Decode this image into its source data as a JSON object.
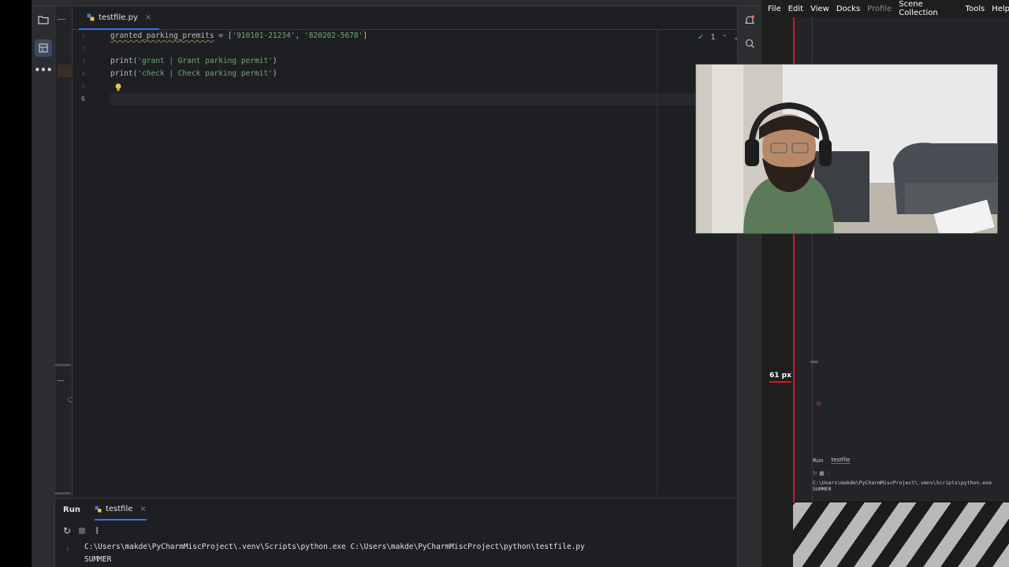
{
  "editor": {
    "file_tab": "testfile.py",
    "tab_close": "×",
    "inspection_count": "1",
    "line_numbers": [
      "1",
      "2",
      "3",
      "4",
      "5",
      "6"
    ],
    "lines": {
      "l1_var": "granted_parking_premits",
      "l1_eq": " = [",
      "l1_s1": "'910101-21234'",
      "l1_comma": ", ",
      "l1_s2": "'820202-5678'",
      "l1_end": "]",
      "l3_fn": "print(",
      "l3_s": "'grant | Grant parking permit'",
      "l3_end": ")",
      "l4_fn": "print(",
      "l4_s": "'check | Check parking permit'",
      "l4_end": ")"
    }
  },
  "run_panel": {
    "title": "Run",
    "tab": "testfile",
    "tab_close": "×",
    "console_lines": [
      "C:\\Users\\makde\\PyCharmMiscProject\\.venv\\Scripts\\python.exe C:\\Users\\makde\\PyCharmMiscProject\\python\\testfile.py",
      "SUMMER"
    ]
  },
  "obs": {
    "menu": [
      "File",
      "Edit",
      "View",
      "Docks",
      "Profile",
      "Scene Collection",
      "Tools",
      "Help"
    ],
    "px_label": "61 px",
    "mini_run": {
      "title": "Run",
      "tab": "testfile",
      "console_lines": [
        "C:\\Users\\makde\\PyCharmMiscProject\\.venv\\Scripts\\python.exe",
        "SUMMER"
      ]
    }
  },
  "colors": {
    "accent": "#3574f0",
    "string": "#6aab73",
    "obs_red": "#e0141d"
  }
}
